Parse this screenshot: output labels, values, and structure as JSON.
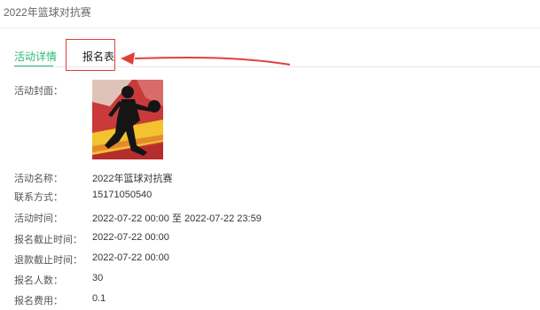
{
  "page": {
    "title": "2022年篮球对抗赛"
  },
  "tabs": [
    {
      "label": "活动详情",
      "active": true
    },
    {
      "label": "报名表",
      "active": false
    }
  ],
  "annotation": {
    "color": "#e0403a"
  },
  "accent_color": "#2eb87a",
  "cover": {
    "label": "活动封面：",
    "icon": "basketball-player-image"
  },
  "fields": [
    {
      "label": "活动名称：",
      "value": "2022年篮球对抗赛"
    },
    {
      "label": "联系方式：",
      "value": "15171050540"
    },
    {
      "label": "活动时间：",
      "value": "2022-07-22 00:00 至 2022-07-22 23:59"
    },
    {
      "label": "报名截止时间：",
      "value": "2022-07-22 00:00"
    },
    {
      "label": "退款截止时间：",
      "value": "2022-07-22 00:00"
    },
    {
      "label": "报名人数：",
      "value": "30"
    },
    {
      "label": "报名费用：",
      "value": "0.1"
    }
  ]
}
